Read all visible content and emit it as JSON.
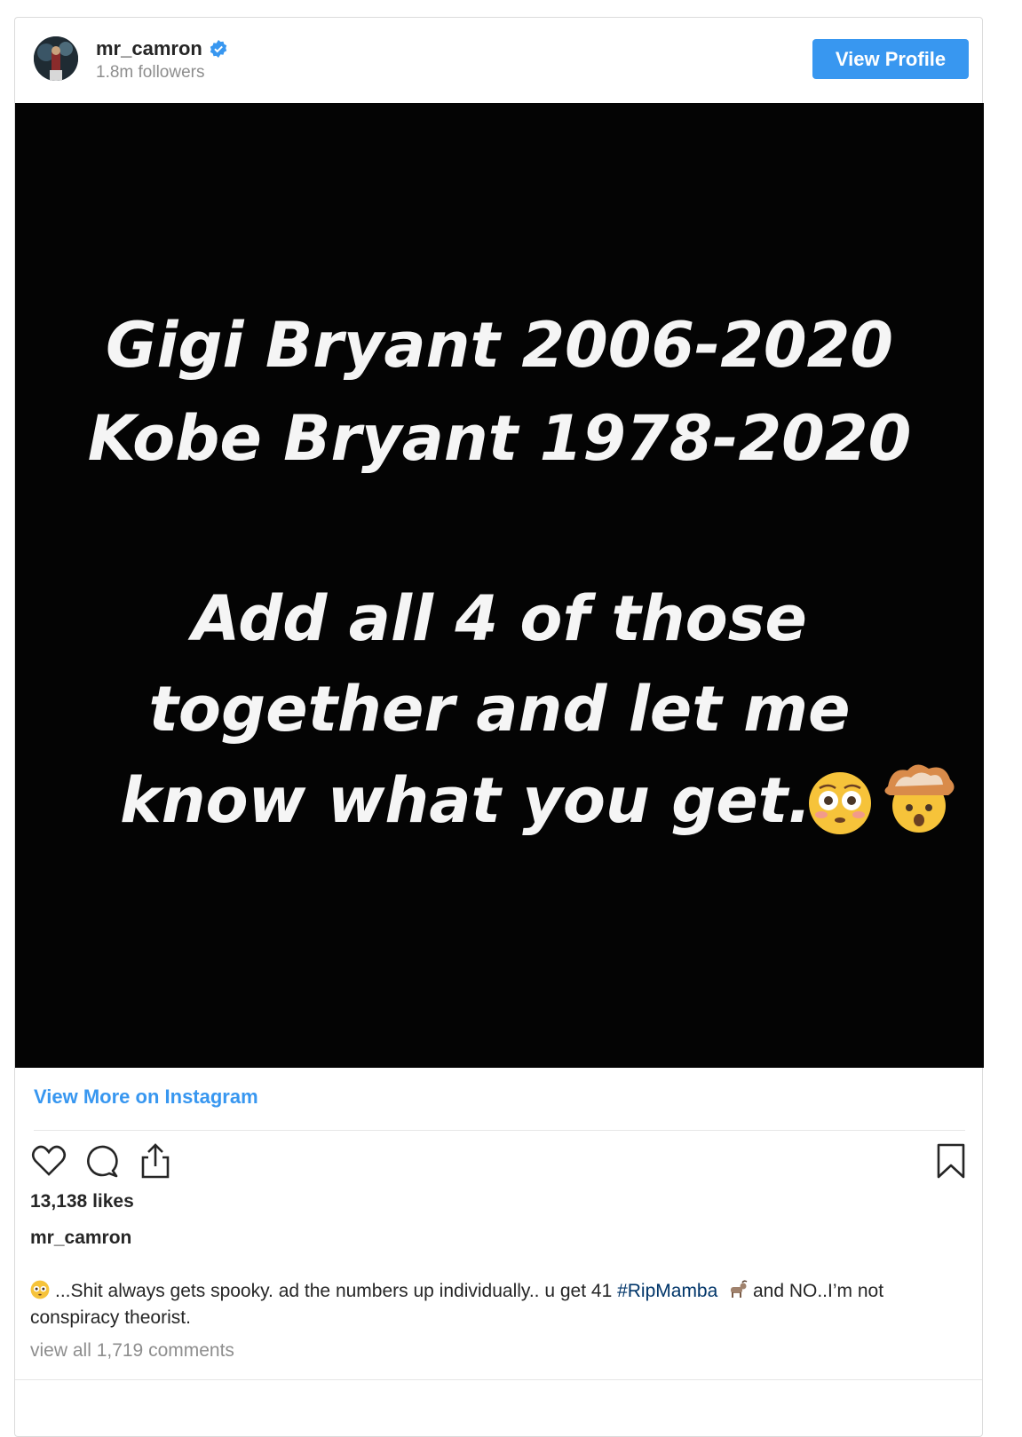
{
  "header": {
    "username": "mr_camron",
    "followers": "1.8m followers",
    "view_profile_label": "View Profile"
  },
  "post_image": {
    "lines": [
      "Gigi Bryant 2006-2020",
      "Kobe Bryant 1978-2020",
      "Add all 4 of those",
      "together and let me",
      "know what you get."
    ],
    "emojis": [
      "flushed-face-icon",
      "exploding-head-icon"
    ]
  },
  "view_more_label": "View More on Instagram",
  "likes": "13,138 likes",
  "caption": {
    "username": "mr_camron",
    "text_before": "...Shit always gets spooky. ad the numbers up individually.. u get 41 ",
    "hashtag": "#RipMamba",
    "text_after": "  and NO..I’m not conspiracy theorist."
  },
  "comments_link": "view all 1,719 comments",
  "colors": {
    "accent": "#3897f0",
    "hashtag": "#003569",
    "muted": "#8e8e8e",
    "text": "#262626"
  }
}
